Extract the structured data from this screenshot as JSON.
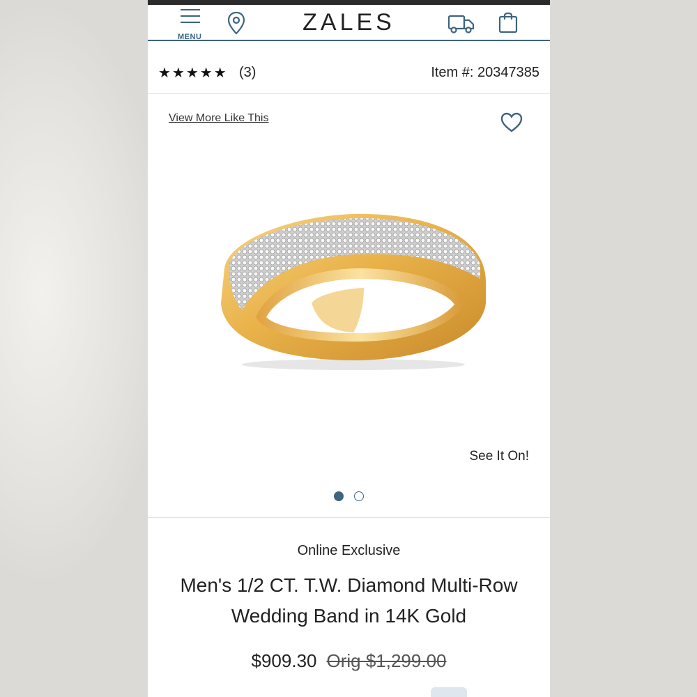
{
  "header": {
    "menu_label": "MENU",
    "logo": "ZALES"
  },
  "product": {
    "rating_stars": "★★★★★",
    "rating_value": 5,
    "review_count": "(3)",
    "item_number": "Item #: 20347385",
    "view_more": "View More Like This",
    "see_it_on": "See It On!",
    "carousel": {
      "current": 1,
      "total": 2
    },
    "badge": "Online Exclusive",
    "title": "Men's 1/2 CT. T.W. Diamond Multi-Row Wedding Band in 14K Gold",
    "price": "$909.30",
    "orig_price": "Orig $1,299.00"
  },
  "colors": {
    "accent": "#3d6481",
    "gold": "#e8b54a",
    "text": "#222222"
  },
  "icons": [
    "menu-icon",
    "location-pin-icon",
    "truck-icon",
    "shopping-bag-icon",
    "heart-icon"
  ]
}
